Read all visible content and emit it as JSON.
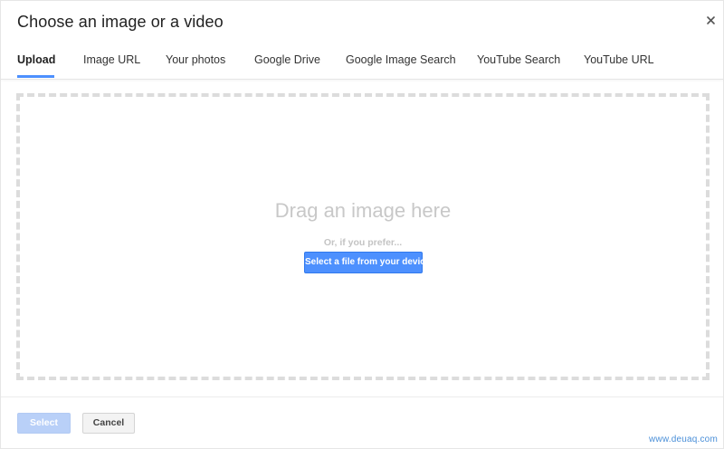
{
  "dialog": {
    "title": "Choose an image or a video",
    "close_icon": "close-icon"
  },
  "tabs": [
    {
      "label": "Upload",
      "active": true
    },
    {
      "label": "Image URL",
      "active": false
    },
    {
      "label": "Your photos",
      "active": false
    },
    {
      "label": "Google Drive",
      "active": false
    },
    {
      "label": "Google Image Search",
      "active": false
    },
    {
      "label": "YouTube Search",
      "active": false
    },
    {
      "label": "YouTube URL",
      "active": false
    }
  ],
  "dropzone": {
    "drag_text": "Drag an image here",
    "or_text": "Or, if you prefer...",
    "select_file_label": "Select a file from your device"
  },
  "footer": {
    "select_label": "Select",
    "cancel_label": "Cancel"
  },
  "watermark": "www.deuaq.com",
  "colors": {
    "accent": "#4d90fe",
    "disabled_accent": "#b9d0f8",
    "dropzone_border": "#dcdcdc"
  }
}
